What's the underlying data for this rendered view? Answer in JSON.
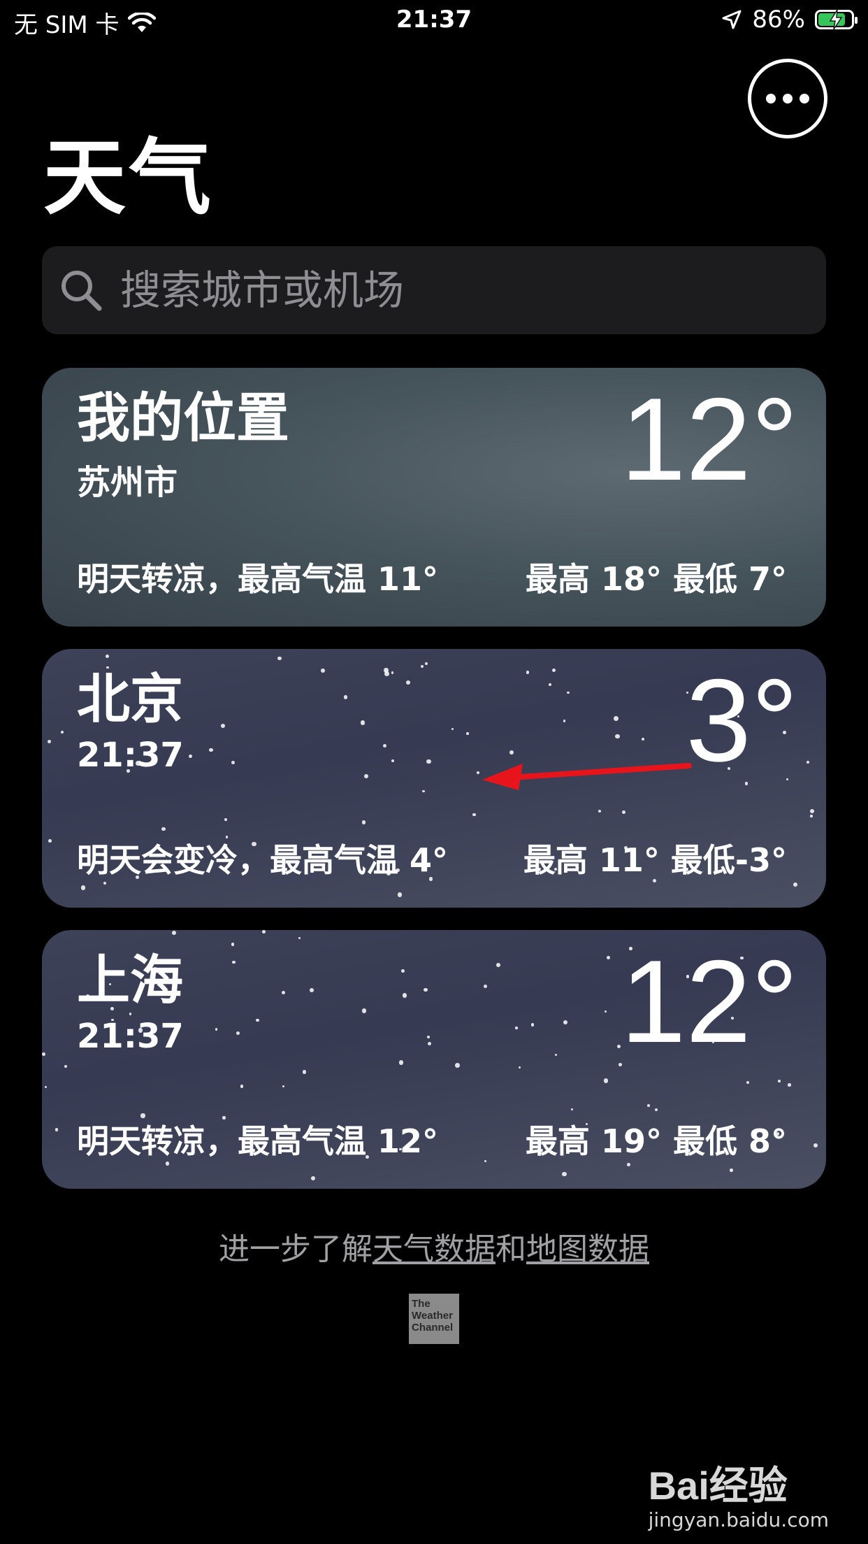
{
  "status_bar": {
    "carrier": "无 SIM 卡",
    "time": "21:37",
    "battery_percent": "86%",
    "battery_level": 0.86,
    "battery_color": "#35c759"
  },
  "header": {
    "title": "天气",
    "more_icon": "ellipsis-circle-icon"
  },
  "search": {
    "placeholder": "搜索城市或机场",
    "icon": "search-icon"
  },
  "cities": [
    {
      "name": "我的位置",
      "subline": "苏州市",
      "temperature": "12°",
      "summary": "明天转凉，最高气温 11°",
      "high_low": "最高 18°  最低 7°"
    },
    {
      "name": "北京",
      "subline": "21:37",
      "temperature": "3°",
      "summary": "明天会变冷，最高气温 4°",
      "high_low": "最高 11°  最低-3°"
    },
    {
      "name": "上海",
      "subline": "21:37",
      "temperature": "12°",
      "summary": "明天转凉，最高气温 12°",
      "high_low": "最高 19°  最低 8°"
    }
  ],
  "footer": {
    "prefix": "进一步了解",
    "link_weather": "天气数据",
    "conjunction": "和",
    "link_map": "地图数据",
    "logo_lines": [
      "The",
      "Weather",
      "Channel"
    ]
  },
  "watermark": {
    "brand": "Bai经验",
    "url": "jingyan.baidu.com"
  },
  "annotation": {
    "arrow_color": "#e8141b"
  }
}
